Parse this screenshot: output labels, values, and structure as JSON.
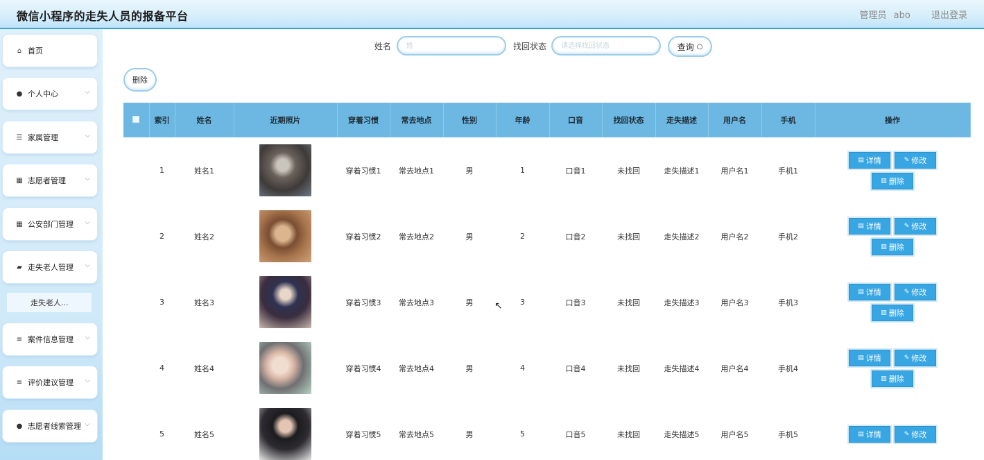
{
  "header": {
    "title": "微信小程序的走失人员的报备平台",
    "role_label": "管理员",
    "username": "abo",
    "logout_label": "退出登录"
  },
  "sidebar": {
    "items": [
      {
        "label": "首页",
        "icon": "home-icon",
        "glyph": "⌂",
        "has_chevron": false
      },
      {
        "label": "个人中心",
        "icon": "user-icon",
        "glyph": "●",
        "has_chevron": true
      },
      {
        "label": "家属管理",
        "icon": "sliders-icon",
        "glyph": "☰",
        "has_chevron": true
      },
      {
        "label": "志愿者管理",
        "icon": "grid-icon",
        "glyph": "▦",
        "has_chevron": true
      },
      {
        "label": "公安部门管理",
        "icon": "grid-icon",
        "glyph": "▦",
        "has_chevron": true
      },
      {
        "label": "走失老人管理",
        "icon": "folder-icon",
        "glyph": "▰",
        "has_chevron": true
      },
      {
        "label": "案件信息管理",
        "icon": "list-icon",
        "glyph": "≡",
        "has_chevron": true
      },
      {
        "label": "评价建议管理",
        "icon": "list-icon",
        "glyph": "≡",
        "has_chevron": true
      },
      {
        "label": "志愿者线索管理",
        "icon": "bulb-icon",
        "glyph": "●",
        "has_chevron": true
      }
    ],
    "sub_item": "走失老人..."
  },
  "search": {
    "name_label": "姓名",
    "name_placeholder": "姓",
    "status_label": "找回状态",
    "status_placeholder": "请选择找回状态",
    "query_label": "查询",
    "query_icon": "search-icon"
  },
  "toolbar": {
    "delete_label": "删除"
  },
  "table": {
    "columns": [
      "索引",
      "姓名",
      "近期照片",
      "穿着习惯",
      "常去地点",
      "性别",
      "年龄",
      "口音",
      "找回状态",
      "走失描述",
      "用户名",
      "手机",
      "操作"
    ],
    "rows": [
      {
        "index": "1",
        "name": "姓名1",
        "habit": "穿着习惯1",
        "place": "常去地点1",
        "gender": "男",
        "age": "1",
        "accent": "口音1",
        "status": "未找回",
        "desc": "走失描述1",
        "user": "用户名1",
        "phone": "手机1"
      },
      {
        "index": "2",
        "name": "姓名2",
        "habit": "穿着习惯2",
        "place": "常去地点2",
        "gender": "男",
        "age": "2",
        "accent": "口音2",
        "status": "未找回",
        "desc": "走失描述2",
        "user": "用户名2",
        "phone": "手机2"
      },
      {
        "index": "3",
        "name": "姓名3",
        "habit": "穿着习惯3",
        "place": "常去地点3",
        "gender": "男",
        "age": "3",
        "accent": "口音3",
        "status": "未找回",
        "desc": "走失描述3",
        "user": "用户名3",
        "phone": "手机3"
      },
      {
        "index": "4",
        "name": "姓名4",
        "habit": "穿着习惯4",
        "place": "常去地点4",
        "gender": "男",
        "age": "4",
        "accent": "口音4",
        "status": "未找回",
        "desc": "走失描述4",
        "user": "用户名4",
        "phone": "手机4"
      },
      {
        "index": "5",
        "name": "姓名5",
        "habit": "穿着习惯5",
        "place": "常去地点5",
        "gender": "男",
        "age": "5",
        "accent": "口音5",
        "status": "未找回",
        "desc": "走失描述5",
        "user": "用户名5",
        "phone": "手机5"
      }
    ],
    "actions": {
      "detail_label": "详情",
      "edit_label": "修改",
      "delete_label": "删除"
    }
  },
  "colors": {
    "accent": "#38a6e2",
    "header_row": "#6db8e2",
    "header_border": "#35a3e0"
  }
}
